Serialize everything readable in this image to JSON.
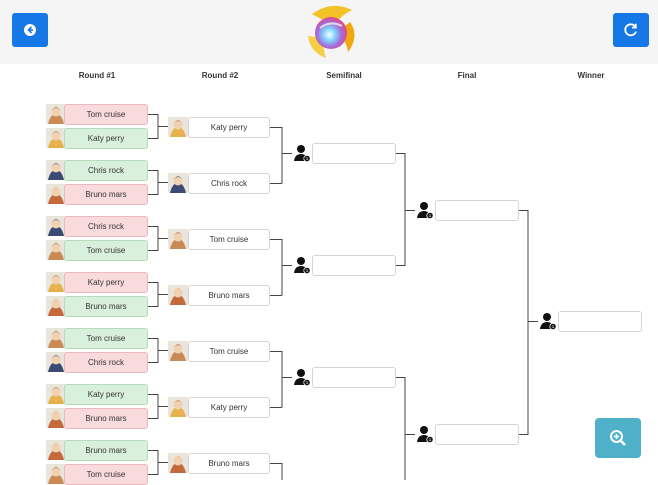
{
  "header": {
    "back_icon": "back-arrow-icon",
    "reset_icon": "refresh-icon",
    "logo_icon": "smash-ball-logo"
  },
  "rounds": {
    "r1": "Round #1",
    "r2": "Round #2",
    "semi": "Semifinal",
    "final": "Final",
    "winner": "Winner"
  },
  "round1": [
    {
      "name": "Tom cruise",
      "result": "lose"
    },
    {
      "name": "Katy perry",
      "result": "win"
    },
    {
      "name": "Chris rock",
      "result": "win"
    },
    {
      "name": "Bruno mars",
      "result": "lose"
    },
    {
      "name": "Chris rock",
      "result": "lose"
    },
    {
      "name": "Tom cruise",
      "result": "win"
    },
    {
      "name": "Katy perry",
      "result": "lose"
    },
    {
      "name": "Bruno mars",
      "result": "win"
    },
    {
      "name": "Tom cruise",
      "result": "win"
    },
    {
      "name": "Chris rock",
      "result": "lose"
    },
    {
      "name": "Katy perry",
      "result": "win"
    },
    {
      "name": "Bruno mars",
      "result": "lose"
    },
    {
      "name": "Bruno mars",
      "result": "win"
    },
    {
      "name": "Tom cruise",
      "result": "lose"
    }
  ],
  "round2": [
    "Katy perry",
    "Chris rock",
    "Tom cruise",
    "Bruno mars",
    "Tom cruise",
    "Katy perry",
    "Bruno mars"
  ],
  "semifinal": [
    "",
    "",
    "",
    ""
  ],
  "final": [
    "",
    ""
  ],
  "winner": "",
  "zoom_icon": "zoom-in-icon",
  "colors": {
    "primary": "#1677e6",
    "win": "#d9f0dc",
    "lose": "#f9dadd",
    "zoom": "#4fb1c9"
  }
}
